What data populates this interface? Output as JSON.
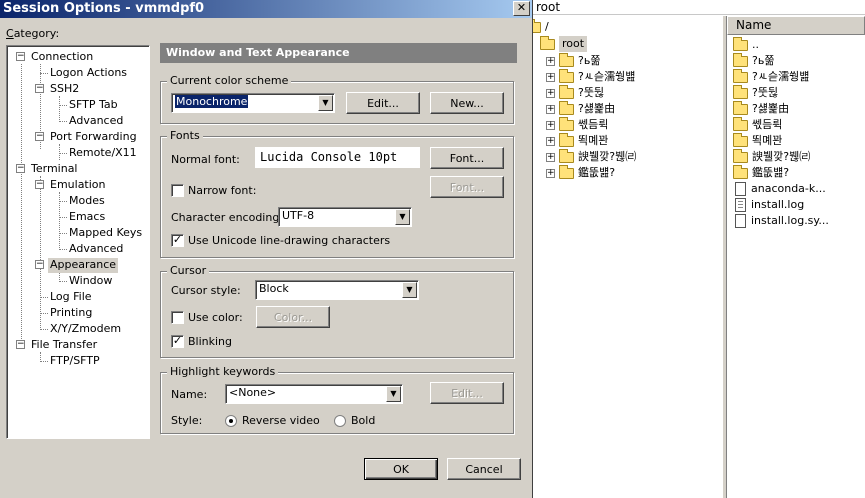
{
  "background": {
    "path": "root",
    "tree": {
      "top_item": "/",
      "root_item": "root",
      "children": [
        "?ь쭒",
        "?ㅻ슫濡쒕뱶",
        "?뚯뒪",
        "?섏뾽由",
        "쎇듬뤽",
        "뙥몌꽌",
        "諛뷀깢?붾㈃",
        "鑑뚮뱶?"
      ]
    },
    "list": {
      "column_name": "Name",
      "items": [
        {
          "name": "..",
          "kind": "folder"
        },
        {
          "name": "?ь쭒",
          "kind": "folder"
        },
        {
          "name": "?ㅻ슫濡쒕뱶",
          "kind": "folder"
        },
        {
          "name": "?뚯뒪",
          "kind": "folder"
        },
        {
          "name": "?섏뾽由",
          "kind": "folder"
        },
        {
          "name": "쎇듬뤽",
          "kind": "folder"
        },
        {
          "name": "뙥몌꽌",
          "kind": "folder"
        },
        {
          "name": "諛뷀깢?붾㈃",
          "kind": "folder"
        },
        {
          "name": "鑑뚮뱶?",
          "kind": "folder"
        },
        {
          "name": "anaconda-k...",
          "kind": "file"
        },
        {
          "name": "install.log",
          "kind": "textfile"
        },
        {
          "name": "install.log.sy...",
          "kind": "file"
        }
      ]
    }
  },
  "dialog": {
    "title": "Session Options - vmmdpf0",
    "close_glyph": "✕",
    "category_label": "Category:",
    "category": {
      "connection": "Connection",
      "logon_actions": "Logon Actions",
      "ssh2": "SSH2",
      "sftp_tab": "SFTP Tab",
      "ssh2_advanced": "Advanced",
      "port_forwarding": "Port Forwarding",
      "remote_x11": "Remote/X11",
      "terminal": "Terminal",
      "emulation": "Emulation",
      "modes": "Modes",
      "emacs": "Emacs",
      "mapped_keys": "Mapped Keys",
      "emulation_advanced": "Advanced",
      "appearance": "Appearance",
      "window": "Window",
      "log_file": "Log File",
      "printing": "Printing",
      "xyzmodem": "X/Y/Zmodem",
      "file_transfer": "File Transfer",
      "ftp_sftp": "FTP/SFTP"
    },
    "panel_title": "Window and Text Appearance",
    "color_scheme": {
      "group": "Current color scheme",
      "value": "Monochrome",
      "edit": "Edit...",
      "new": "New..."
    },
    "fonts": {
      "group": "Fonts",
      "normal_font_label": "Normal font:",
      "normal_font_value": "Lucida Console 10pt",
      "font_button": "Font...",
      "narrow_font_label": "Narrow font:",
      "narrow_font_button": "Font...",
      "encoding_label": "Character encoding:",
      "encoding_value": "UTF-8",
      "unicode_label": "Use Unicode line-drawing characters",
      "narrow_checked": false,
      "unicode_checked": true
    },
    "cursor": {
      "group": "Cursor",
      "style_label": "Cursor style:",
      "style_value": "Block",
      "use_color_label": "Use color:",
      "color_button": "Color...",
      "blinking_label": "Blinking",
      "use_color_checked": false,
      "blinking_checked": true
    },
    "highlight": {
      "group": "Highlight keywords",
      "name_label": "Name:",
      "name_value": "<None>",
      "edit_button": "Edit...",
      "style_label": "Style:",
      "reverse_video": "Reverse video",
      "bold": "Bold"
    },
    "ok": "OK",
    "cancel": "Cancel",
    "check_glyph": "✓",
    "arrow_glyph": "▼",
    "plus_glyph": "+",
    "minus_glyph": "−",
    "colors": {
      "title_gradient_start": "#0a246a",
      "title_gradient_end": "#a6caf0",
      "face": "#d4d0c8",
      "selection": "#0a246a"
    }
  }
}
